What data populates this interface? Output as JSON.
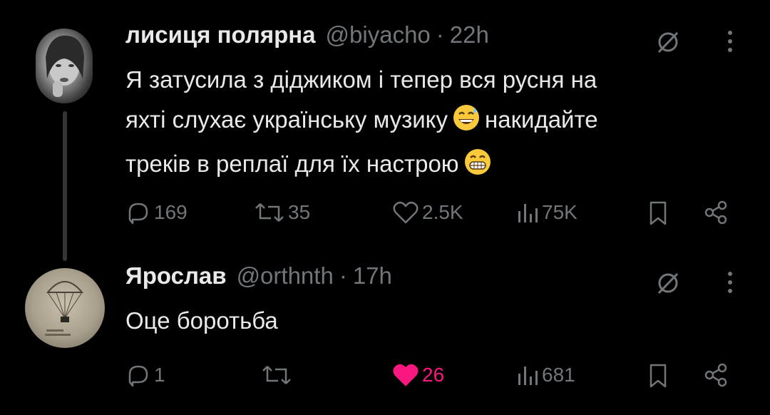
{
  "tweets": [
    {
      "name": "лисиця полярна",
      "handle": "@biyacho",
      "separator": "·",
      "time": "22h",
      "text_line1": "Я затусила з діджиком і тепер вся русня на",
      "text_line2": "яхті слухає українську музику",
      "text_line2b": "накидайте",
      "text_line3": "треків в реплаї для їх настрою",
      "emoji_1": "😅",
      "emoji_2": "😁",
      "replies": "169",
      "reposts": "35",
      "likes": "2.5K",
      "views": "75K",
      "liked": false
    },
    {
      "name": "Ярослав",
      "handle": "@orthnth",
      "separator": "·",
      "time": "17h",
      "text": "Оце боротьба",
      "replies": "1",
      "reposts": "",
      "likes": "26",
      "views": "681",
      "liked": true
    }
  ],
  "icons": {
    "reply": "reply-icon",
    "repost": "repost-icon",
    "like": "like-icon",
    "views": "views-icon",
    "bookmark": "bookmark-icon",
    "share": "share-icon",
    "grok": "grok-icon",
    "more": "more-icon"
  },
  "colors": {
    "background": "#000000",
    "text": "#e7e9ea",
    "muted": "#71767b",
    "like": "#f91880",
    "thread_line": "#333639"
  }
}
